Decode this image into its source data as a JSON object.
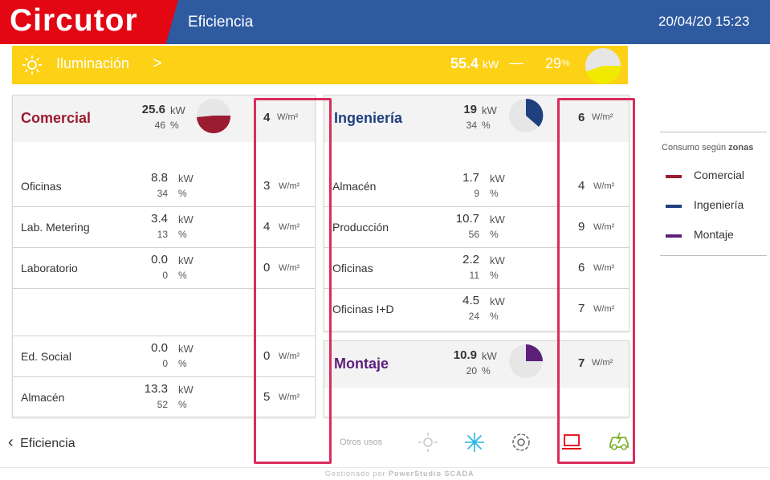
{
  "header": {
    "logo": "Circutor",
    "title": "Eficiencia",
    "datetime": "20/04/20 15:23"
  },
  "lighting": {
    "icon": "sun-icon",
    "label": "Iluminación",
    "arrow": ">",
    "kw": "55.4",
    "kw_unit": "kW",
    "dash": "—",
    "pct": "29",
    "pct_unit": "%"
  },
  "commercial": {
    "title": "Comercial",
    "kw": "25.6",
    "kw_unit": "kW",
    "pct": "46",
    "pct_unit": "%",
    "density": "4",
    "density_unit": "W/m²",
    "color": "#9b1b30",
    "rows": [
      {
        "label": "Oficinas",
        "kw": "8.8",
        "pct": "34",
        "density": "3"
      },
      {
        "label": "Lab. Metering",
        "kw": "3.4",
        "pct": "13",
        "density": "4"
      },
      {
        "label": "Laboratorio",
        "kw": "0.0",
        "pct": "0",
        "density": "0"
      },
      {
        "label": "Ed. Social",
        "kw": "0.0",
        "pct": "0",
        "density": "0"
      },
      {
        "label": "Almacén",
        "kw": "13.3",
        "pct": "52",
        "density": "5"
      }
    ]
  },
  "engineering": {
    "title": "Ingeniería",
    "kw": "19",
    "kw_unit": "kW",
    "pct": "34",
    "pct_unit": "%",
    "density": "6",
    "density_unit": "W/m²",
    "color": "#1f3f7f",
    "rows": [
      {
        "label": "Almacén",
        "kw": "1.7",
        "pct": "9",
        "density": "4"
      },
      {
        "label": "Producción",
        "kw": "10.7",
        "pct": "56",
        "density": "9"
      },
      {
        "label": "Oficinas",
        "kw": "2.2",
        "pct": "11",
        "density": "6"
      },
      {
        "label": "Oficinas I+D",
        "kw": "4.5",
        "pct": "24",
        "density": "7"
      }
    ]
  },
  "assembly": {
    "title": "Montaje",
    "kw": "10.9",
    "kw_unit": "kW",
    "pct": "20",
    "pct_unit": "%",
    "density": "7",
    "density_unit": "W/m²",
    "color": "#5c1f7a"
  },
  "legend": {
    "title_prefix": "Consumo según ",
    "title_bold": "zonas",
    "items": [
      {
        "label": "Comercial",
        "color": "#9b1b30"
      },
      {
        "label": "Ingeniería",
        "color": "#1f3f7f"
      },
      {
        "label": "Montaje",
        "color": "#5c1f7a"
      }
    ]
  },
  "footer": {
    "back_label": "Eficiencia",
    "back_arrow": "‹",
    "otros_usos": "Otros usos",
    "managed_by": "Gestionado por ",
    "managed_by_bold": "PowerStudio SCADA",
    "icons": [
      "sun-icon",
      "snowflake-icon",
      "gear-icon",
      "laptop-icon",
      "ev-charger-icon"
    ]
  },
  "units": {
    "kw": "kW",
    "pct": "%",
    "wm2": "W/m²"
  }
}
